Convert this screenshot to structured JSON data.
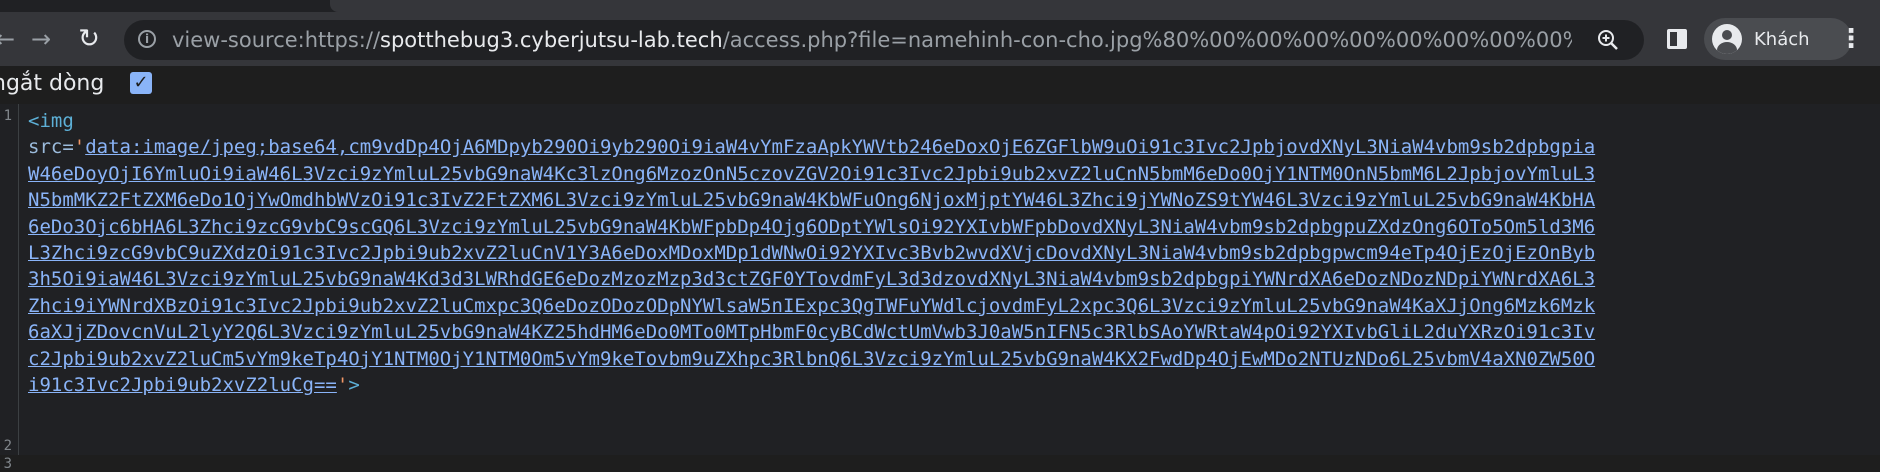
{
  "toolbar": {
    "back_glyph": "←",
    "forward_glyph": "→",
    "reload_glyph": "↻",
    "info_glyph": "i",
    "url_prefix": "view-source:https://",
    "url_host": "spotthebug3.cyberjutsu-lab.tech",
    "url_path": "/access.php?file=namehinh-con-cho.jpg%80%00%00%00%00%00%00%00%00%00%00%00%00%00%0...",
    "profile_name": "Khách",
    "menu_glyph": "⋮",
    "icons": [
      "info-icon",
      "zoom-icon",
      "side-panel-icon",
      "avatar-icon",
      "menu-icon"
    ]
  },
  "wrap": {
    "label": "ngắt dòng",
    "checked": true,
    "check_glyph": "✓"
  },
  "source": {
    "line_numbers": [
      "1",
      "2",
      "3"
    ],
    "tag_open": "<img",
    "attr_name": "src=",
    "quote": "'",
    "base64_lines": [
      "data:image/jpeg;base64,cm9vdDp4OjA6MDpyb290Oi9yb290Oi9iaW4vYmFzaApkYWVtb246eDoxOjE6ZGFlbW9uOi91c3Ivc2JpbjovdXNyL3NiaW4vbm9sb2dpbgpia",
      "W46eDoyOjI6YmluOi9iaW46L3Vzci9zYmluL25vbG9naW4Kc3lzOng6MzozOnN5czovZGV2Oi91c3Ivc2Jpbi9ub2xvZ2luCnN5bmM6eDo0OjY1NTM0OnN5bmM6L2JpbjovYmluL3",
      "N5bmMKZ2FtZXM6eDo1OjYwOmdhbWVzOi91c3IvZ2FtZXM6L3Vzci9zYmluL25vbG9naW4KbWFuOng6NjoxMjptYW46L3Zhci9jYWNoZS9tYW46L3Vzci9zYmluL25vbG9naW4KbHA",
      "6eDo3Ojc6bHA6L3Zhci9zcG9vbC9scGQ6L3Vzci9zYmluL25vbG9naW4KbWFpbDp4Ojg6ODptYWlsOi92YXIvbWFpbDovdXNyL3NiaW4vbm9sb2dpbgpuZXdzOng6OTo5Om5ld3M6",
      "L3Zhci9zcG9vbC9uZXdzOi91c3Ivc2Jpbi9ub2xvZ2luCnV1Y3A6eDoxMDoxMDp1dWNwOi92YXIvc3Bvb2wvdXVjcDovdXNyL3NiaW4vbm9sb2dpbgpwcm94eTp4OjEzOjEzOnByb",
      "3h5Oi9iaW46L3Vzci9zYmluL25vbG9naW4Kd3d3LWRhdGE6eDozMzozMzp3d3ctZGF0YTovdmFyL3d3dzovdXNyL3NiaW4vbm9sb2dpbgpiYWNrdXA6eDozNDozNDpiYWNrdXA6L3",
      "Zhci9iYWNrdXBzOi91c3Ivc2Jpbi9ub2xvZ2luCmxpc3Q6eDozODozODpNYWlsaW5nIExpc3QgTWFuYWdlcjovdmFyL2xpc3Q6L3Vzci9zYmluL25vbG9naW4KaXJjOng6Mzk6Mzk",
      "6aXJjZDovcnVuL2lyY2Q6L3Vzci9zYmluL25vbG9naW4KZ25hdHM6eDo0MTo0MTpHbmF0cyBCdWctUmVwb3J0aW5nIFN5c3RlbSAoYWRtaW4pOi92YXIvbGliL2duYXRzOi91c3Iv",
      "c2Jpbi9ub2xvZ2luCm5vYm9keTp4OjY1NTM0OjY1NTM0Om5vYm9keTovbm9uZXhpc3RlbnQ6L3Vzci9zYmluL25vbG9naW4KX2FwdDp4OjEwMDo2NTUzNDo6L25vbmV4aXN0ZW50O",
      "i91c3Ivc2Jpbi9ub2xvZ2luCg=="
    ],
    "tag_close": ">"
  },
  "colors": {
    "page_bg": "#202124",
    "toolbar_bg": "#35363a",
    "link": "#8ab4f8",
    "tag": "#5db0d7",
    "quote": "#f29766"
  }
}
